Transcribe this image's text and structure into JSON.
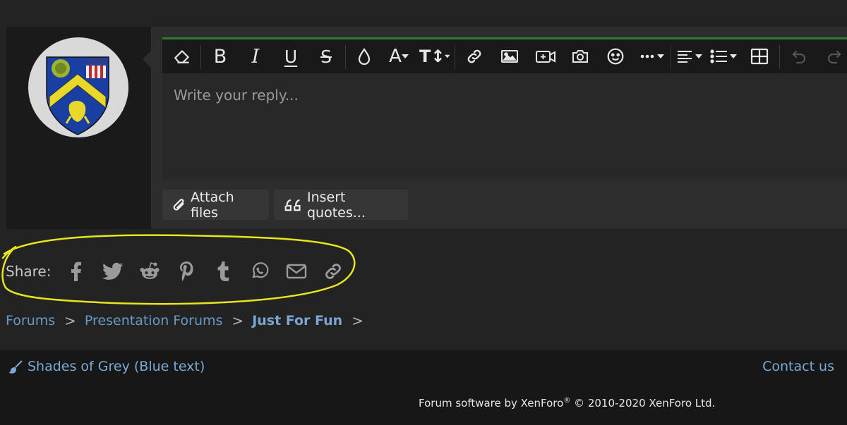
{
  "editor": {
    "placeholder": "Write your reply...",
    "accent_color": "#2f7d32",
    "toolbar": [
      {
        "name": "remove-formatting",
        "icon": "eraser-icon"
      },
      {
        "name": "bold",
        "label": "B"
      },
      {
        "name": "italic",
        "label": "I"
      },
      {
        "name": "underline",
        "label": "U"
      },
      {
        "name": "strikethrough",
        "label": "S"
      },
      {
        "name": "text-color",
        "icon": "droplet-icon"
      },
      {
        "name": "font-family",
        "label": "A"
      },
      {
        "name": "font-size",
        "label": "TI"
      },
      {
        "name": "insert-link",
        "icon": "link-icon"
      },
      {
        "name": "insert-image",
        "icon": "image-icon"
      },
      {
        "name": "insert-media",
        "icon": "video-plus-icon"
      },
      {
        "name": "insert-screenshot",
        "icon": "camera-icon"
      },
      {
        "name": "smilies",
        "icon": "smile-icon"
      },
      {
        "name": "more-options",
        "icon": "ellipsis-icon"
      },
      {
        "name": "align",
        "icon": "align-left-icon"
      },
      {
        "name": "list",
        "icon": "list-icon"
      },
      {
        "name": "insert-table",
        "icon": "table-icon"
      },
      {
        "name": "undo",
        "icon": "undo-icon"
      },
      {
        "name": "redo",
        "icon": "redo-icon"
      }
    ]
  },
  "actions": {
    "attach_label": "Attach files",
    "quotes_label": "Insert quotes..."
  },
  "share": {
    "label": "Share:",
    "icons": [
      "facebook-icon",
      "twitter-icon",
      "reddit-icon",
      "pinterest-icon",
      "tumblr-icon",
      "whatsapp-icon",
      "email-icon",
      "link-icon"
    ]
  },
  "breadcrumb": {
    "items": [
      "Forums",
      "Presentation Forums",
      "Just For Fun"
    ],
    "separator": ">"
  },
  "footer": {
    "style_label": "Shades of Grey (Blue text)",
    "contact_label": "Contact us",
    "copyright_prefix": "Forum software by XenForo",
    "copyright_mark": "®",
    "copyright_suffix": " © 2010-2020 XenForo Ltd."
  },
  "colors": {
    "link": "#6a9ac4",
    "annotation": "#e6e61a"
  }
}
